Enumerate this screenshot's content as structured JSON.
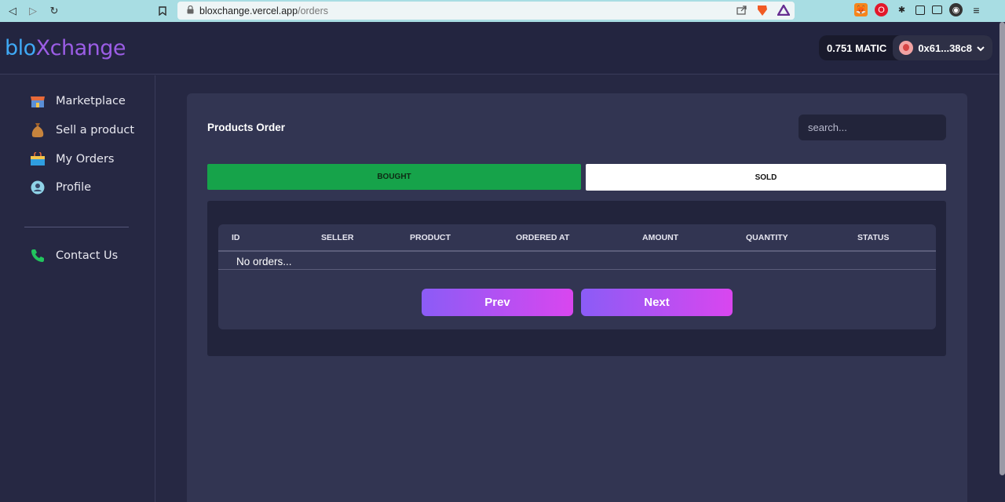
{
  "browser": {
    "url_host": "bloxchange.vercel.app",
    "url_path": "/orders"
  },
  "header": {
    "logo_part1": "blo",
    "logo_part2": "Xchange",
    "balance": "0.751 MATIC",
    "account": "0x61...38c8"
  },
  "sidebar": {
    "items": [
      {
        "label": "Marketplace",
        "icon": "shop-icon"
      },
      {
        "label": "Sell a product",
        "icon": "money-bag-icon"
      },
      {
        "label": "My Orders",
        "icon": "shopping-bag-icon"
      },
      {
        "label": "Profile",
        "icon": "profile-icon"
      },
      {
        "label": "Contact Us",
        "icon": "phone-icon"
      }
    ]
  },
  "main": {
    "title": "Products Order",
    "search_placeholder": "search...",
    "tabs": [
      "BOUGHT",
      "SOLD"
    ],
    "columns": [
      "ID",
      "SELLER",
      "PRODUCT",
      "ORDERED AT",
      "AMOUNT",
      "QUANTITY",
      "STATUS"
    ],
    "empty_text": "No orders...",
    "prev_label": "Prev",
    "next_label": "Next"
  },
  "colors": {
    "accent_green": "#16a34a",
    "gradient_start": "#8b5cf6",
    "gradient_end": "#d946ef"
  }
}
